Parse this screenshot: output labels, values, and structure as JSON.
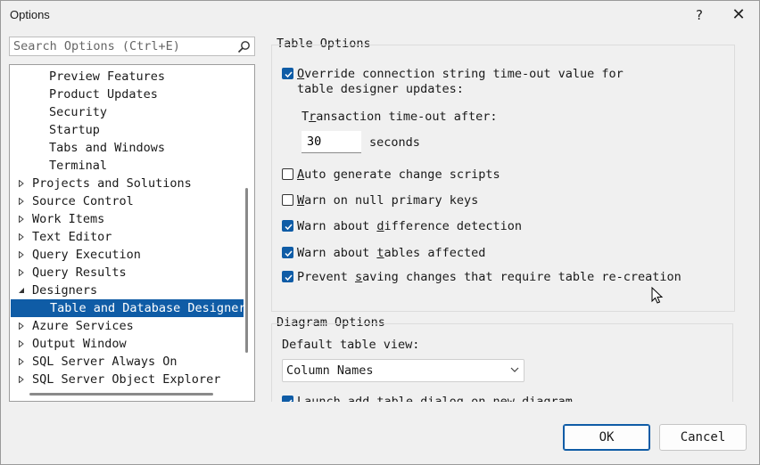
{
  "window": {
    "title": "Options",
    "help_glyph": "?",
    "close_glyph": "✕"
  },
  "search": {
    "placeholder": "Search Options (Ctrl+E)"
  },
  "tree": {
    "items": [
      {
        "label": "Preview Features",
        "depth": 1,
        "expand": "none",
        "selected": false
      },
      {
        "label": "Product Updates",
        "depth": 1,
        "expand": "none",
        "selected": false
      },
      {
        "label": "Security",
        "depth": 1,
        "expand": "none",
        "selected": false
      },
      {
        "label": "Startup",
        "depth": 1,
        "expand": "none",
        "selected": false
      },
      {
        "label": "Tabs and Windows",
        "depth": 1,
        "expand": "none",
        "selected": false
      },
      {
        "label": "Terminal",
        "depth": 1,
        "expand": "none",
        "selected": false
      },
      {
        "label": "Projects and Solutions",
        "depth": 0,
        "expand": "collapsed",
        "selected": false
      },
      {
        "label": "Source Control",
        "depth": 0,
        "expand": "collapsed",
        "selected": false
      },
      {
        "label": "Work Items",
        "depth": 0,
        "expand": "collapsed",
        "selected": false
      },
      {
        "label": "Text Editor",
        "depth": 0,
        "expand": "collapsed",
        "selected": false
      },
      {
        "label": "Query Execution",
        "depth": 0,
        "expand": "collapsed",
        "selected": false
      },
      {
        "label": "Query Results",
        "depth": 0,
        "expand": "collapsed",
        "selected": false
      },
      {
        "label": "Designers",
        "depth": 0,
        "expand": "expanded",
        "selected": false
      },
      {
        "label": "Table and Database Designers",
        "depth": 1,
        "expand": "none",
        "selected": true
      },
      {
        "label": "Azure Services",
        "depth": 0,
        "expand": "collapsed",
        "selected": false
      },
      {
        "label": "Output Window",
        "depth": 0,
        "expand": "collapsed",
        "selected": false
      },
      {
        "label": "SQL Server Always On",
        "depth": 0,
        "expand": "collapsed",
        "selected": false
      },
      {
        "label": "SQL Server Object Explorer",
        "depth": 0,
        "expand": "collapsed",
        "selected": false
      }
    ]
  },
  "table_options": {
    "title": "Table Options",
    "override_timeout": {
      "checked": true,
      "line1_pre": "",
      "line1_key": "O",
      "line1_post": "verride connection string time-out value for",
      "line2": "table designer updates:"
    },
    "transaction_label_pre": "T",
    "transaction_label_key": "r",
    "transaction_label_post": "ansaction time-out after:",
    "timeout_value": "30",
    "timeout_unit": "seconds",
    "checkboxes": [
      {
        "checked": false,
        "pre": "",
        "key": "A",
        "post": "uto generate change scripts"
      },
      {
        "checked": false,
        "pre": "",
        "key": "W",
        "post": "arn on null primary keys"
      },
      {
        "checked": true,
        "pre": "Warn about ",
        "key": "d",
        "post": "ifference detection"
      },
      {
        "checked": true,
        "pre": "Warn about ",
        "key": "t",
        "post": "ables affected"
      },
      {
        "checked": true,
        "pre": "Prevent ",
        "key": "s",
        "post": "aving changes that require table re-creation"
      }
    ]
  },
  "diagram_options": {
    "title": "Diagram Options",
    "default_view_label": "Default table view:",
    "default_view_value": "Column Names",
    "launch_add_table": {
      "checked": true,
      "text": "Launch add table dialog on new diagram"
    }
  },
  "buttons": {
    "ok": "OK",
    "cancel": "Cancel"
  },
  "colors": {
    "accent": "#0f5ca6",
    "background": "#f0f0f0"
  }
}
